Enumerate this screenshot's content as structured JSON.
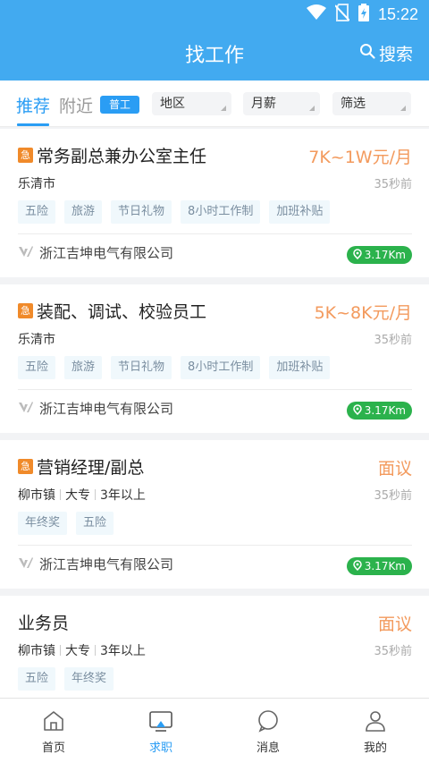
{
  "status_bar": {
    "time": "15:22",
    "icons": [
      "wifi-icon",
      "no-sim-icon",
      "battery-charging-icon"
    ]
  },
  "header": {
    "title": "找工作",
    "search_label": "搜索",
    "search_icon": "search-icon"
  },
  "filter_bar": {
    "tabs": [
      {
        "label": "推荐",
        "active": true
      },
      {
        "label": "附近",
        "active": false
      }
    ],
    "tag": "普工",
    "dropdowns": [
      {
        "label": "地区"
      },
      {
        "label": "月薪"
      },
      {
        "label": "筛选"
      }
    ]
  },
  "jobs": [
    {
      "urgent_label": "急",
      "title": "常务副总兼办公室主任",
      "salary": "7K~1W元/月",
      "location": [
        "乐清市"
      ],
      "time": "35秒前",
      "tags": [
        "五险",
        "旅游",
        "节日礼物",
        "8小时工作制",
        "加班补贴"
      ],
      "company": "浙江吉坤电气有限公司",
      "distance": "3.17Km"
    },
    {
      "urgent_label": "急",
      "title": "装配、调试、校验员工",
      "salary": "5K~8K元/月",
      "location": [
        "乐清市"
      ],
      "time": "35秒前",
      "tags": [
        "五险",
        "旅游",
        "节日礼物",
        "8小时工作制",
        "加班补贴"
      ],
      "company": "浙江吉坤电气有限公司",
      "distance": "3.17Km"
    },
    {
      "urgent_label": "急",
      "title": "营销经理/副总",
      "salary": "面议",
      "location": [
        "柳市镇",
        "大专",
        "3年以上"
      ],
      "time": "35秒前",
      "tags": [
        "年终奖",
        "五险"
      ],
      "company": "浙江吉坤电气有限公司",
      "distance": "3.17Km"
    },
    {
      "urgent_label": "",
      "title": "业务员",
      "salary": "面议",
      "location": [
        "柳市镇",
        "大专",
        "3年以上"
      ],
      "time": "35秒前",
      "tags": [
        "五险",
        "年终奖"
      ],
      "company": "",
      "distance": ""
    }
  ],
  "bottom_nav": [
    {
      "label": "首页",
      "icon": "home-icon",
      "active": false
    },
    {
      "label": "求职",
      "icon": "job-search-icon",
      "active": true
    },
    {
      "label": "消息",
      "icon": "message-icon",
      "active": false
    },
    {
      "label": "我的",
      "icon": "profile-icon",
      "active": false
    }
  ],
  "colors": {
    "primary": "#42aaf0",
    "accent_blue": "#2a9df4",
    "salary": "#f39a5d",
    "urgent": "#f08a2a",
    "distance": "#2bb24c"
  }
}
